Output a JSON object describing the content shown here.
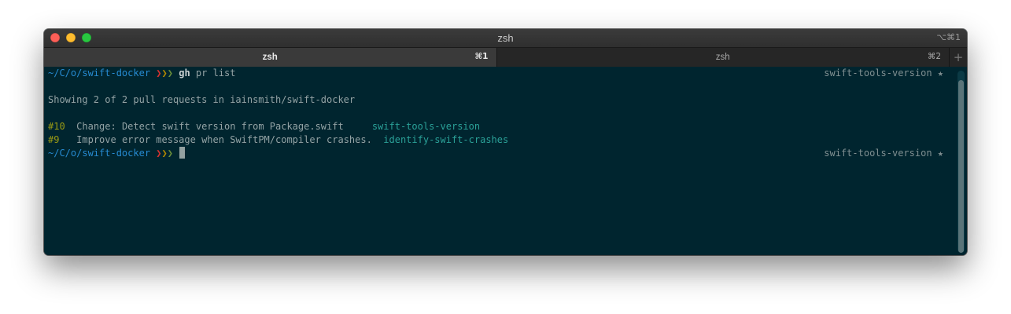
{
  "window": {
    "title": "zsh",
    "title_shortcut": "⌥⌘1"
  },
  "tabs": [
    {
      "label": "zsh",
      "shortcut": "⌘1",
      "active": true
    },
    {
      "label": "zsh",
      "shortcut": "⌘2",
      "active": false
    }
  ],
  "new_tab_label": "+",
  "prompt": {
    "cwd": "~/C/o/swift-docker",
    "arrow_red": "❯",
    "arrow_yellow": "❯",
    "arrow_green": "❯",
    "right_prompt": "swift-tools-version ★"
  },
  "terminal": {
    "command": "gh",
    "command_args": " pr list",
    "summary": "Showing 2 of 2 pull requests in iainsmith/swift-docker",
    "pull_requests": [
      {
        "number": "#10",
        "title": "Change: Detect swift version from Package.swift     ",
        "branch": "swift-tools-version"
      },
      {
        "number": "#9",
        "title": "Improve error message when SwiftPM/compiler crashes.  ",
        "branch": "identify-swift-crashes"
      }
    ]
  },
  "colors": {
    "background": "#00252f",
    "cwd": "#268bd2",
    "branch": "#2aa198",
    "pr_number": "#9a9b14"
  }
}
